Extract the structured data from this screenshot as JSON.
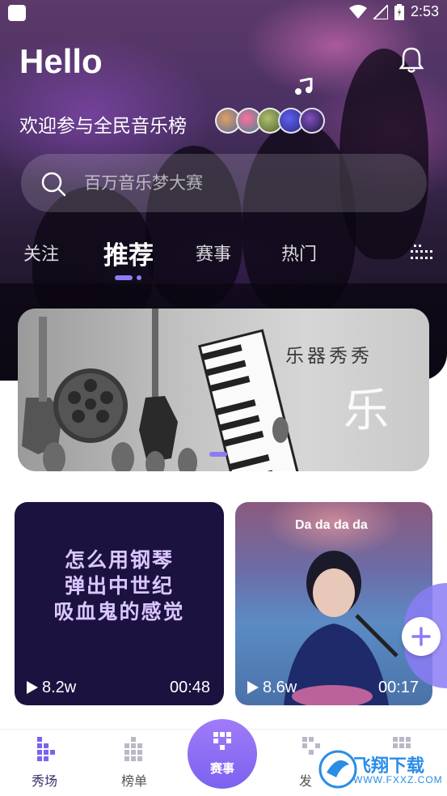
{
  "status_bar": {
    "time": "2:53"
  },
  "header": {
    "greeting": "Hello",
    "subtitle": "欢迎参与全民音乐榜"
  },
  "search": {
    "placeholder": "百万音乐梦大赛"
  },
  "tabs": [
    {
      "label": "关注",
      "active": false
    },
    {
      "label": "推荐",
      "active": true
    },
    {
      "label": "赛事",
      "active": false
    },
    {
      "label": "热门",
      "active": false
    }
  ],
  "banner": {
    "title": "乐器秀秀",
    "big_char": "乐"
  },
  "videos": [
    {
      "text_lines": [
        "怎么用钢琴",
        "弹出中世纪",
        "吸血鬼的感觉"
      ],
      "plays": "8.2w",
      "duration": "00:48"
    },
    {
      "lyric": "Da da da da",
      "plays": "8.6w",
      "duration": "00:17"
    }
  ],
  "bottom_nav": {
    "items": [
      {
        "label": "秀场",
        "active": true
      },
      {
        "label": "榜单",
        "active": false
      },
      {
        "label": "赛事",
        "active": false,
        "center": true
      },
      {
        "label": "发",
        "active": false
      },
      {
        "label": "",
        "active": false
      }
    ]
  },
  "watermark": {
    "text": "飞翔下载",
    "sub": "WWW.FXXZ.COM"
  },
  "colors": {
    "accent": "#8b7cf6",
    "card_dark": "#1c1240"
  }
}
